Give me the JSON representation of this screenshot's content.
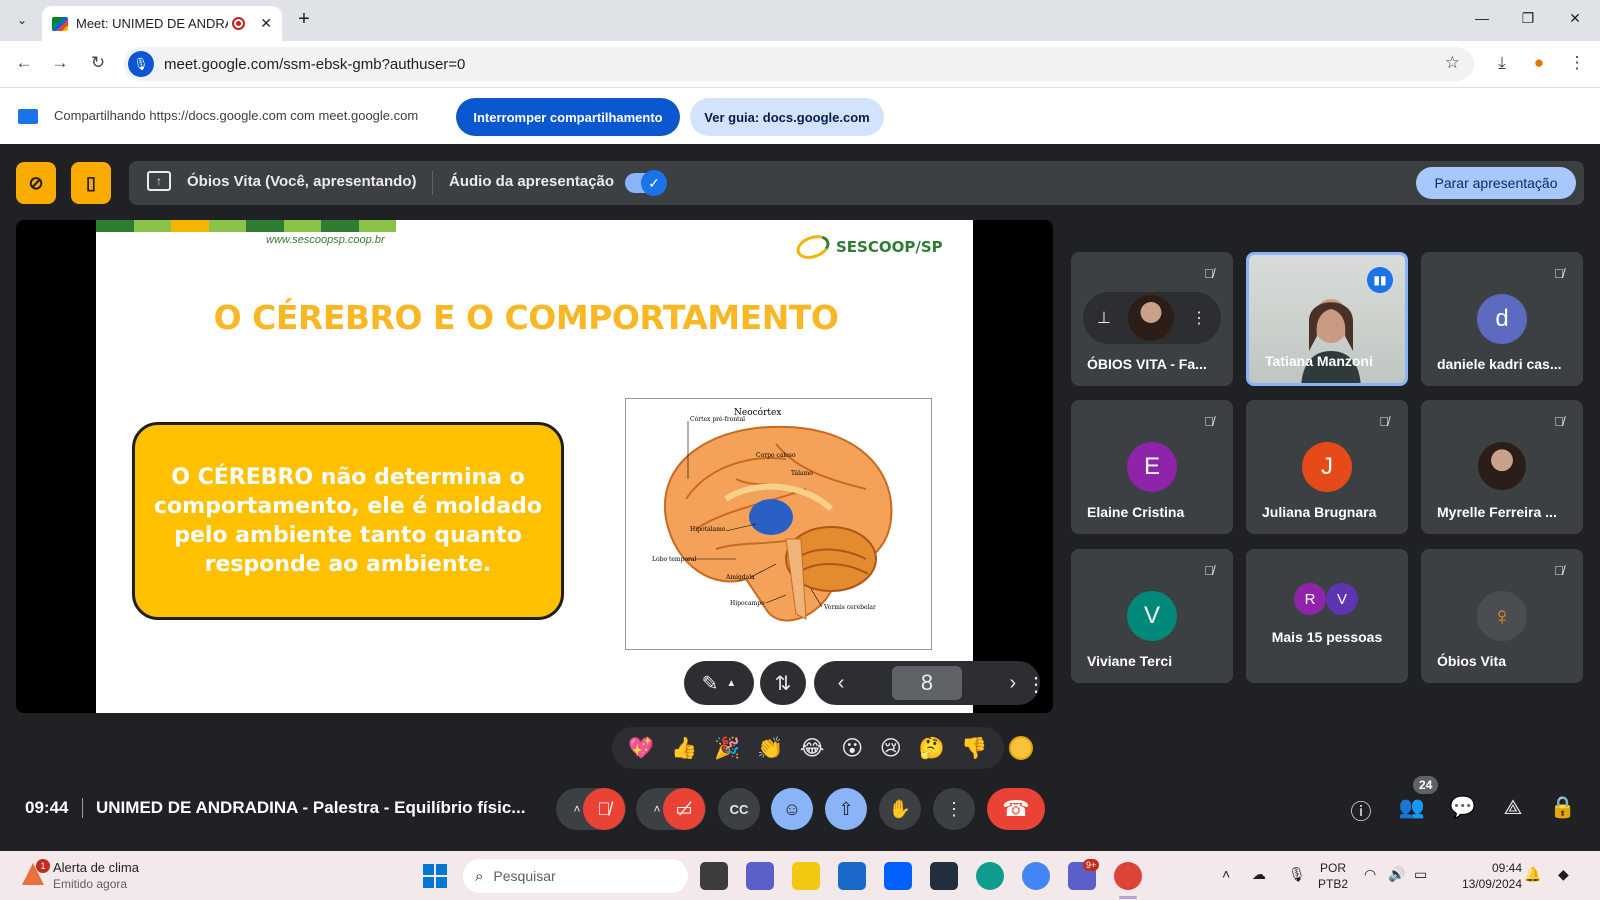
{
  "browser": {
    "tab_title": "Meet: UNIMED DE ANDRAD",
    "new_tab": "+",
    "tab_close": "✕",
    "url": "meet.google.com/ssm-ebsk-gmb?authuser=0",
    "window_controls": {
      "minimize": "—",
      "restore": "❐",
      "close": "✕"
    },
    "nav": {
      "back": "←",
      "forward": "→",
      "reload": "↻"
    },
    "toolbar_icons": {
      "star": "☆",
      "download": "⤓",
      "extension": "●",
      "menu": "⋮"
    }
  },
  "infobar": {
    "text": "Compartilhando https://docs.google.com com meet.google.com",
    "stop_button": "Interromper compartilhamento",
    "guide_button": "Ver guia: docs.google.com"
  },
  "presenter_bar": {
    "title": "Óbios Vita (Você, apresentando)",
    "audio_label": "Áudio da apresentação",
    "audio_on": true,
    "stop_button": "Parar apresentação"
  },
  "slide": {
    "url": "www.sescoopsp.coop.br",
    "logo_text": "SESCOOP/SP",
    "title": "O CÉREBRO E O COMPORTAMENTO",
    "box_text": "O CÉREBRO não determina o comportamento, ele é moldado pelo ambiente tanto quanto responde ao ambiente.",
    "figure_labels": {
      "neocortex": "Neocórtex",
      "cortex_prefrontal": "Córtex pré-frontal",
      "corpo_caloso": "Corpo caloso",
      "talamo": "Tálamo",
      "hipotalamo": "Hipotálamo",
      "lobo_temporal": "Lobo temporal",
      "amigdala": "Amígdala",
      "hipocampo": "Hipocampo",
      "vermis": "Vermis cerebelar"
    },
    "page_number": "8"
  },
  "participants": [
    {
      "name": "ÓBIOS VITA - Fa...",
      "muted": true,
      "type": "pinned-photo"
    },
    {
      "name": "Tatiana Manzoni",
      "muted": false,
      "type": "video"
    },
    {
      "name": "daniele kadri cas...",
      "muted": true,
      "initial": "d",
      "color": "#5c6bc0"
    },
    {
      "name": "Elaine Cristina",
      "muted": true,
      "initial": "E",
      "color": "#8e24aa"
    },
    {
      "name": "Juliana Brugnara",
      "muted": true,
      "initial": "J",
      "color": "#e64a19"
    },
    {
      "name": "Myrelle Ferreira ...",
      "muted": true,
      "type": "photo"
    },
    {
      "name": "Viviane Terci",
      "muted": true,
      "initial": "V",
      "color": "#00897b"
    },
    {
      "name": "Mais 15 pessoas",
      "initials": [
        "R",
        "V"
      ],
      "colors": [
        "#8e24aa",
        "#5e35b1"
      ]
    },
    {
      "name": "Óbios Vita",
      "muted": true,
      "type": "logo"
    }
  ],
  "reactions": [
    "💖",
    "👍",
    "🎉",
    "👏",
    "😂",
    "😮",
    "😢",
    "🤔",
    "👎"
  ],
  "bottom_bar": {
    "time": "09:44",
    "meeting_title": "UNIMED DE ANDRADINA - Palestra - Equilíbrio físic...",
    "people_count": "24"
  },
  "taskbar": {
    "weather_title": "Alerta de clima",
    "weather_sub": "Emitido agora",
    "weather_badge": "1",
    "search_placeholder": "Pesquisar",
    "lang_top": "POR",
    "lang_bottom": "PTB2",
    "clock_time": "09:44",
    "clock_date": "13/09/2024",
    "teams_badge": "9+"
  }
}
